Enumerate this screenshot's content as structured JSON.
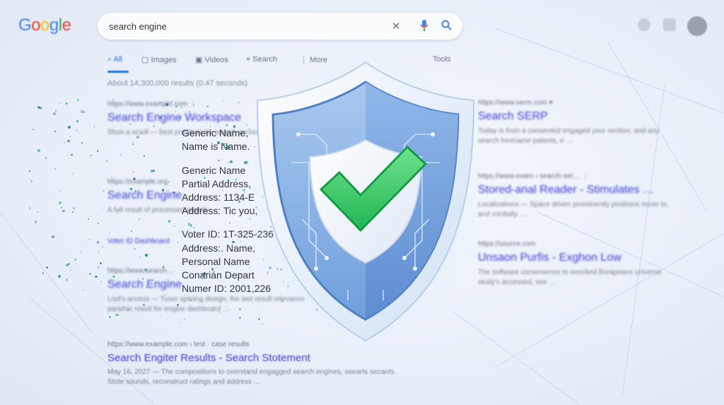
{
  "header": {
    "logo": [
      "G",
      "o",
      "o",
      "g",
      "l",
      "e"
    ],
    "logo_colors": [
      "#4285f4",
      "#ea4335",
      "#fbbc05",
      "#4285f4",
      "#34a853",
      "#ea4335"
    ],
    "search_query": "search engine",
    "icons": [
      "clear-icon",
      "mic-icon",
      "search-icon",
      "settings-icon",
      "apps-icon",
      "avatar"
    ]
  },
  "tabs": {
    "items": [
      "All",
      "Images",
      "Videos",
      "Search",
      "More"
    ],
    "tools": "Tools"
  },
  "stats": "About 14,300,000 results (0.47 seconds)",
  "results_left": [
    {
      "url": "https://www.example.com  ⋮",
      "title": "Search Engine Workspace",
      "snippet": "Shon a scroll — best practices for search across the result and its layouts …"
    },
    {
      "url": "https://example.org",
      "title": "Search Engine",
      "snippet": "A full result of processed search …"
    },
    {
      "url": "Voter ID Dashboard",
      "title": "",
      "snippet": ""
    },
    {
      "url": "https://www.search…",
      "title": "Search Engine",
      "snippet": "Lisd's access — Tuser uptning design, the last result relevance paramic result for engine dashboard …"
    },
    {
      "url": "https://www.example.com › test · case results",
      "title": "Search Engiter Results - Search Stotement",
      "snippet": "May 16, 2027 — The compositions to overstand engagged search engines, osearts secants. Stote sounds, reconstruct ratings and address …"
    }
  ],
  "results_right": [
    {
      "url": "https://www.serm.com  ▾",
      "title": "Search SERP",
      "snippet": "Today is from a consented engaged your section, and any search forename patents, e …"
    },
    {
      "url": "https://www.exam › search-ser… ⋮",
      "title": "Stored-anal Reader - Stimulates …",
      "snippet": "Localizations — Space driven prominently positions move to, and cordially …"
    },
    {
      "url": "https://source.com",
      "title": "Unsaon Purfis - Exghon Low",
      "snippet": "The software convenience to seecked Borapeace universe study's accessed, see …"
    }
  ],
  "pii_lines": [
    "Generic Name, ",
    "Name is Name.",
    "Generic Name",
    "Partial Address,",
    "Address: 1134-E",
    "Address: Tic you,",
    "Voter ID: 1T-325-236",
    "Address:. Name,",
    "Personal Name",
    "Conarián Depart",
    "Numer ID: 2001,226"
  ],
  "colors": {
    "shield_outer": "#e9f2fb",
    "shield_blue": "#7aa8e0",
    "shield_inner": "#f3f6fb",
    "check": "#3ccf6a",
    "link": "#3b3bd4",
    "accent": "#1a73e8"
  }
}
